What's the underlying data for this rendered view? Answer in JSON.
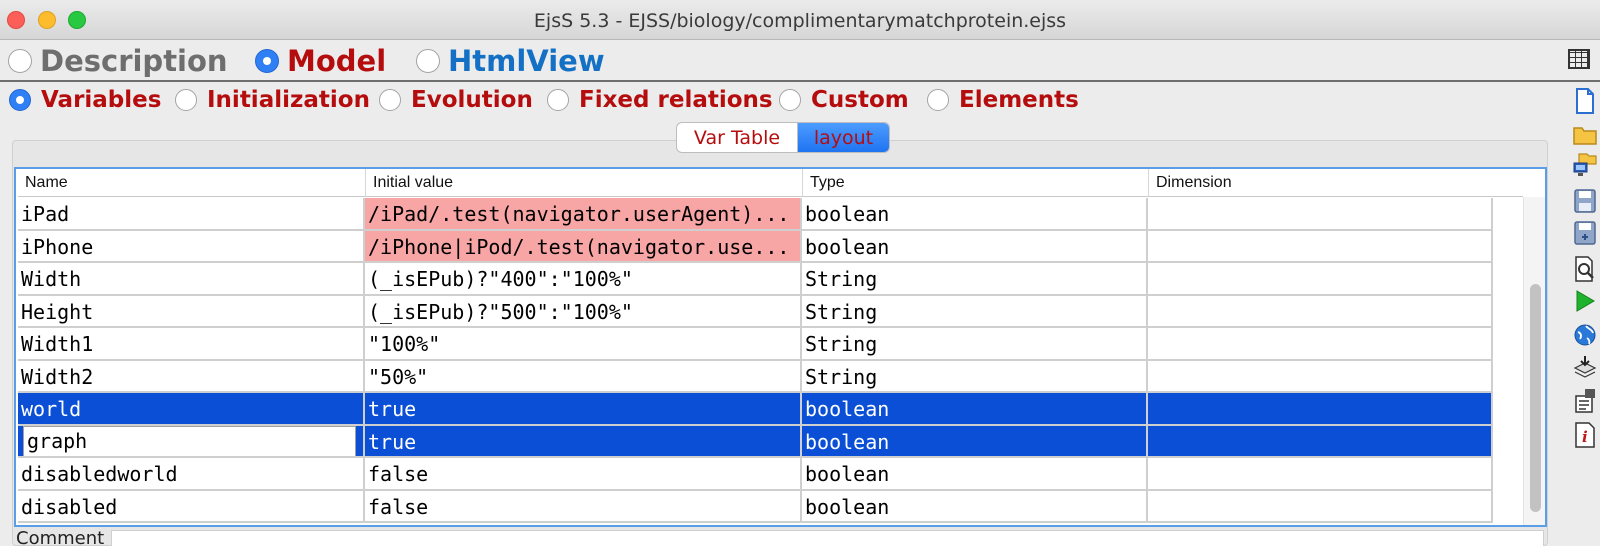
{
  "window": {
    "title": "EjsS 5.3 - EJSS/biology/complimentarymatchprotein.ejss"
  },
  "main_tabs": [
    {
      "label": "Description",
      "selected": false,
      "color": "#6e6e6e"
    },
    {
      "label": "Model",
      "selected": true,
      "color": "#b50d0d"
    },
    {
      "label": "HtmlView",
      "selected": false,
      "color": "#1470c4"
    }
  ],
  "sub_tabs": [
    {
      "label": "Variables",
      "selected": true
    },
    {
      "label": "Initialization",
      "selected": false
    },
    {
      "label": "Evolution",
      "selected": false
    },
    {
      "label": "Fixed relations",
      "selected": false
    },
    {
      "label": "Custom",
      "selected": false
    },
    {
      "label": "Elements",
      "selected": false
    }
  ],
  "segmented": {
    "var_table": "Var Table",
    "layout": "layout",
    "selected": "layout"
  },
  "table": {
    "headers": [
      "Name",
      "Initial value",
      "Type",
      "Dimension"
    ],
    "rows": [
      {
        "name": "iPad",
        "initial": "/iPad/.test(navigator.userAgent)...",
        "type": "boolean",
        "dimension": "",
        "highlight": true,
        "selected": false
      },
      {
        "name": "iPhone",
        "initial": "/iPhone|iPod/.test(navigator.use...",
        "type": "boolean",
        "dimension": "",
        "highlight": true,
        "selected": false
      },
      {
        "name": "Width",
        "initial": "(_isEPub)?\"400\":\"100%\"",
        "type": "String",
        "dimension": "",
        "highlight": false,
        "selected": false
      },
      {
        "name": "Height",
        "initial": "(_isEPub)?\"500\":\"100%\"",
        "type": "String",
        "dimension": "",
        "highlight": false,
        "selected": false
      },
      {
        "name": "Width1",
        "initial": "\"100%\"",
        "type": "String",
        "dimension": "",
        "highlight": false,
        "selected": false
      },
      {
        "name": "Width2",
        "initial": "\"50%\"",
        "type": "String",
        "dimension": "",
        "highlight": false,
        "selected": false
      },
      {
        "name": "world",
        "initial": "true",
        "type": "boolean",
        "dimension": "",
        "highlight": false,
        "selected": true
      },
      {
        "name": "graph",
        "initial": "true",
        "type": "boolean",
        "dimension": "",
        "highlight": false,
        "selected": true,
        "editing": true
      },
      {
        "name": "disabledworld",
        "initial": "false",
        "type": "boolean",
        "dimension": "",
        "highlight": false,
        "selected": false
      },
      {
        "name": "disabled",
        "initial": "false",
        "type": "boolean",
        "dimension": "",
        "highlight": false,
        "selected": false
      }
    ]
  },
  "comment": {
    "label": "Comment",
    "value": ""
  },
  "toolbar_icons": [
    "new-file-icon",
    "open-folder-icon",
    "open-remote-icon",
    "save-icon",
    "save-as-icon",
    "search-icon",
    "run-icon",
    "web-icon",
    "package-icon",
    "settings-icon",
    "info-icon"
  ],
  "colors": {
    "selection": "#0a4fd6",
    "error_highlight": "#f8a5a5",
    "accent": "#2f7ff5"
  }
}
